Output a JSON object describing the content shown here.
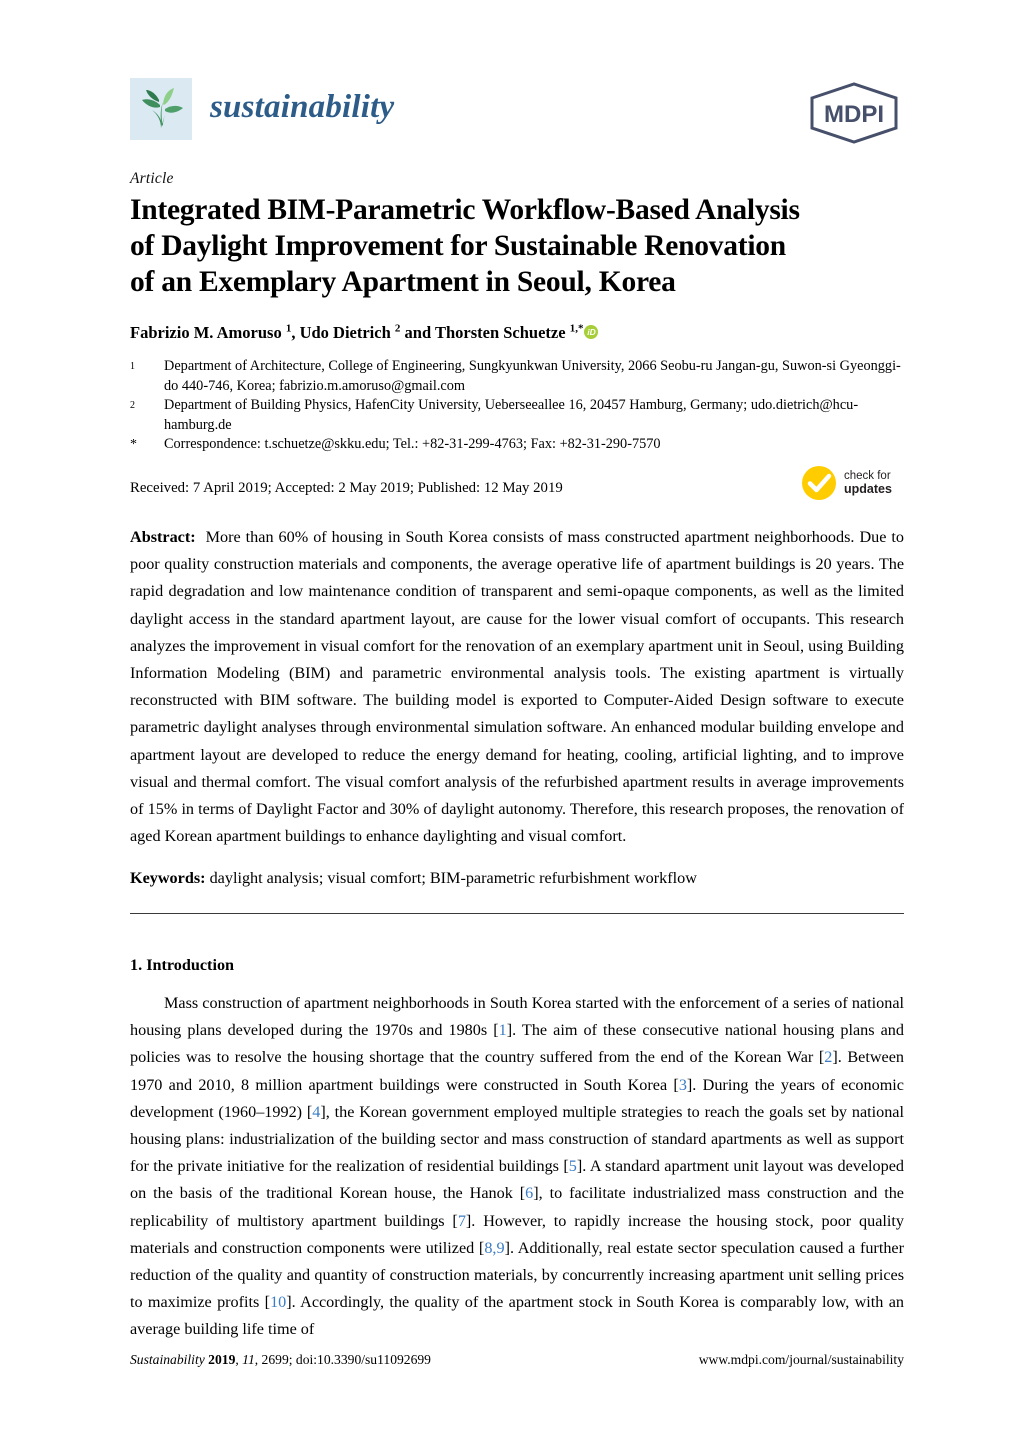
{
  "header": {
    "journal_name": "sustainability",
    "publisher_logo_text": "MDPI",
    "leaf_icon": "leaf-logo-icon"
  },
  "article": {
    "type_label": "Article",
    "title_lines": [
      "Integrated BIM-Parametric Workflow-Based Analysis",
      "of Daylight Improvement for Sustainable Renovation",
      "of an Exemplary Apartment in Seoul, Korea"
    ],
    "title_full": "Integrated BIM-Parametric Workflow-Based Analysis of Daylight Improvement for Sustainable Renovation of an Exemplary Apartment in Seoul, Korea"
  },
  "authors": {
    "line_html": "Fabrizio M. Amoruso <sup>1</sup>, Udo Dietrich <sup>2</sup> and Thorsten Schuetze <sup>1,*</sup>",
    "names": [
      {
        "name": "Fabrizio M. Amoruso",
        "marker": "1"
      },
      {
        "name": "Udo Dietrich",
        "marker": "2"
      },
      {
        "name": "Thorsten Schuetze",
        "marker": "1,*"
      }
    ],
    "orcid_label": "iD"
  },
  "affiliations": [
    {
      "marker": "1",
      "text": "Department of Architecture, College of Engineering, Sungkyunkwan University, 2066 Seobu-ru Jangan-gu, Suwon-si Gyeonggi-do 440-746, Korea; fabrizio.m.amoruso@gmail.com"
    },
    {
      "marker": "2",
      "text": "Department of Building Physics, HafenCity University, Ueberseeallee 16, 20457 Hamburg, Germany; udo.dietrich@hcu-hamburg.de"
    },
    {
      "marker": "*",
      "text": "Correspondence: t.schuetze@skku.edu; Tel.: +82-31-299-4763; Fax: +82-31-290-7570"
    }
  ],
  "dates": {
    "line": "Received: 7 April 2019; Accepted: 2 May 2019; Published: 12 May 2019"
  },
  "check_updates": {
    "line1": "check for",
    "line2": "updates",
    "badge_color": "#FFCC00"
  },
  "abstract": {
    "label": "Abstract:",
    "text": "More than 60% of housing in South Korea consists of mass constructed apartment neighborhoods. Due to poor quality construction materials and components, the average operative life of apartment buildings is 20 years. The rapid degradation and low maintenance condition of transparent and semi-opaque components, as well as the limited daylight access in the standard apartment layout, are cause for the lower visual comfort of occupants. This research analyzes the improvement in visual comfort for the renovation of an exemplary apartment unit in Seoul, using Building Information Modeling (BIM) and parametric environmental analysis tools. The existing apartment is virtually reconstructed with BIM software. The building model is exported to Computer-Aided Design software to execute parametric daylight analyses through environmental simulation software. An enhanced modular building envelope and apartment layout are developed to reduce the energy demand for heating, cooling, artificial lighting, and to improve visual and thermal comfort. The visual comfort analysis of the refurbished apartment results in average improvements of 15% in terms of Daylight Factor and 30% of daylight autonomy. Therefore, this research proposes, the renovation of aged Korean apartment buildings to enhance daylighting and visual comfort."
  },
  "keywords": {
    "label": "Keywords:",
    "text": "daylight analysis; visual comfort; BIM-parametric refurbishment workflow"
  },
  "introduction": {
    "heading": "1. Introduction",
    "paragraph_html": "Mass construction of apartment neighborhoods in South Korea started with the enforcement of a series of national housing plans developed during the 1970s and 1980s [<span class=\"ref\">1</span>]. The aim of these consecutive national housing plans and policies was to resolve the housing shortage that the country suffered from the end of the Korean War [<span class=\"ref\">2</span>]. Between 1970 and 2010, 8 million apartment buildings were constructed in South Korea [<span class=\"ref\">3</span>]. During the years of economic development (1960&ndash;1992) [<span class=\"ref\">4</span>], the Korean government employed multiple strategies to reach the goals set by national housing plans: industrialization of the building sector and mass construction of standard apartments as well as support for the private initiative for the realization of residential buildings [<span class=\"ref\">5</span>]. A standard apartment unit layout was developed on the basis of the traditional Korean house, the Hanok [<span class=\"ref\">6</span>], to facilitate industrialized mass construction and the replicability of multistory apartment buildings [<span class=\"ref\">7</span>]. However, to rapidly increase the housing stock, poor quality materials and construction components were utilized [<span class=\"ref\">8,9</span>]. Additionally, real estate sector speculation caused a further reduction of the quality and quantity of construction materials, by concurrently increasing apartment unit selling prices to maximize profits [<span class=\"ref\">10</span>]. Accordingly, the quality of the apartment stock in South Korea is comparably low, with an average building life time of",
    "citation_numbers": [
      "1",
      "2",
      "3",
      "4",
      "5",
      "6",
      "7",
      "8,9",
      "10"
    ]
  },
  "footer": {
    "left_html": "<i>Sustainability</i> <b>2019</b>, <i>11</i>, 2699; doi:10.3390/su11092699",
    "left_plain": "Sustainability 2019, 11, 2699; doi:10.3390/su11092699",
    "right": "www.mdpi.com/journal/sustainability"
  },
  "colors": {
    "journal_blue": "#2d5c88",
    "mdpi_navy": "#47506b",
    "leaf_bg": "#dbe9f3",
    "leaf_dark": "#3f8f5e",
    "leaf_light": "#8ed08a",
    "orcid_green": "#a6ce39",
    "citation_blue": "#3b7cc4",
    "check_yellow": "#FFCC00"
  }
}
